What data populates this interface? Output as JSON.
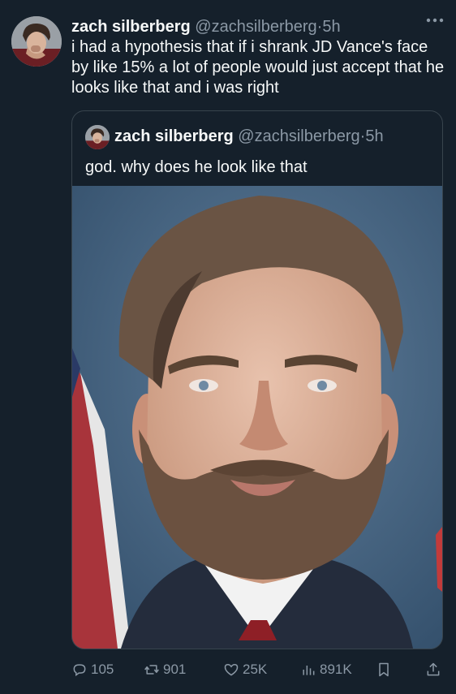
{
  "tweet": {
    "author_name": "zach silberberg",
    "author_handle": "@zachsilberberg",
    "separator": "·",
    "time": "5h",
    "more_icon": "more-horizontal-icon",
    "text": "i had a hypothesis that if i shrank JD Vance's face by like 15% a lot of people would just accept that he looks like that and i was right"
  },
  "quoted_tweet": {
    "author_name": "zach silberberg",
    "author_handle": "@zachsilberberg",
    "separator": "·",
    "time": "5h",
    "text": "god. why does he look like that",
    "image": "portrait-photo"
  },
  "actions": {
    "replies": "105",
    "retweets": "901",
    "likes": "25K",
    "views": "891K",
    "icons": [
      "reply-icon",
      "retweet-icon",
      "like-icon",
      "views-icon",
      "bookmark-icon",
      "share-icon"
    ]
  },
  "colors": {
    "background": "#15202b",
    "text": "#f7f9f9",
    "secondary_text": "#8b98a5",
    "border": "#38444d"
  }
}
